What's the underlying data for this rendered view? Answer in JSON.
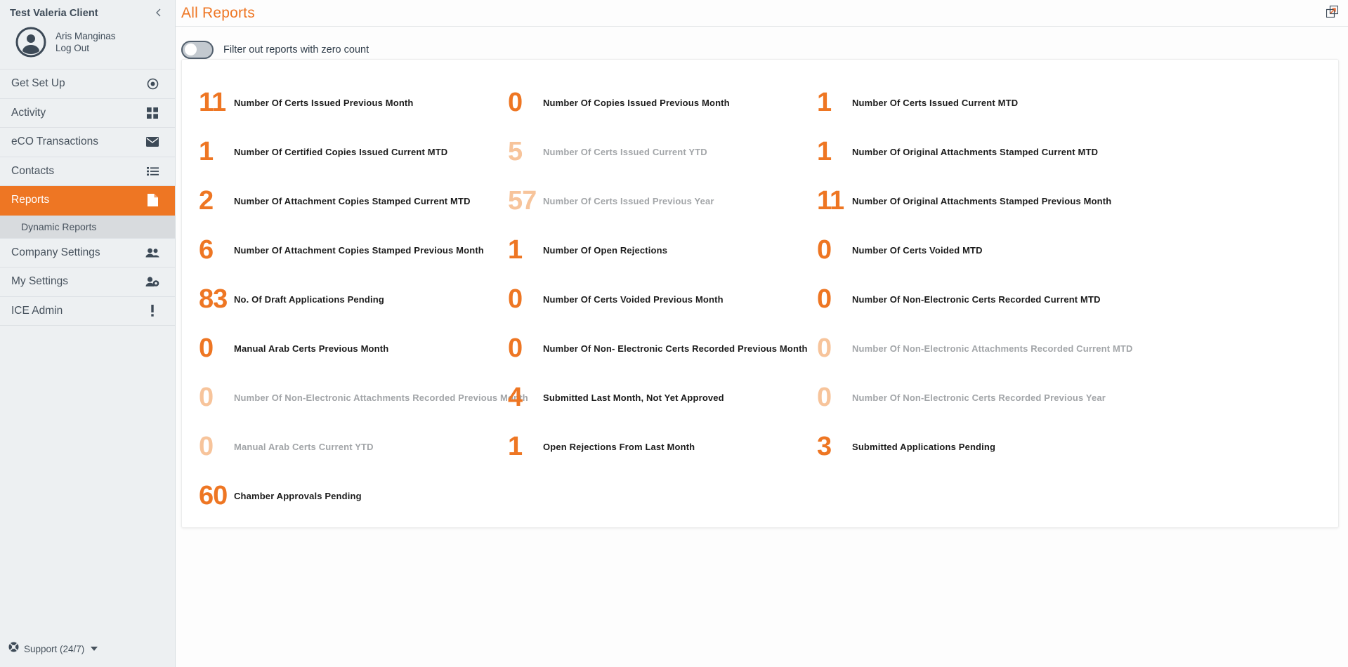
{
  "sidebar": {
    "client_name": "Test Valeria Client",
    "collapse_icon": "chevron-left-icon",
    "user": {
      "name": "Aris Manginas",
      "logout_label": "Log Out",
      "avatar_icon": "user-circle-icon"
    },
    "items": [
      {
        "label": "Get Set Up",
        "icon": "target-icon",
        "active": false
      },
      {
        "label": "Activity",
        "icon": "grid-icon",
        "active": false
      },
      {
        "label": "eCO Transactions",
        "icon": "envelope-icon",
        "active": false
      },
      {
        "label": "Contacts",
        "icon": "list-icon",
        "active": false
      },
      {
        "label": "Reports",
        "icon": "document-icon",
        "active": true
      },
      {
        "label": "Company Settings",
        "icon": "people-icon",
        "active": false
      },
      {
        "label": "My Settings",
        "icon": "user-gear-icon",
        "active": false
      },
      {
        "label": "ICE Admin",
        "icon": "exclamation-icon",
        "active": false
      }
    ],
    "sub_item": {
      "label": "Dynamic Reports",
      "parent": "Reports"
    },
    "footer": {
      "label": "Support (24/7)",
      "icon": "lifebuoy-icon",
      "caret": "caret-down-icon"
    }
  },
  "header": {
    "title": "All Reports",
    "expand_icon": "expand-window-icon"
  },
  "filter": {
    "toggle_state": "off",
    "label": "Filter out reports with zero count"
  },
  "colors": {
    "accent": "#ee7623",
    "accent_dim": "#f7c49b",
    "sidebar_bg": "#edf0f2",
    "text": "#47525d",
    "text_dim": "#a2a5a8"
  },
  "reports": {
    "columns": [
      [
        {
          "value": "11",
          "label": "Number Of Certs Issued Previous Month",
          "dim": false
        },
        {
          "value": "1",
          "label": "Number Of Certified Copies Issued Current MTD",
          "dim": false
        },
        {
          "value": "2",
          "label": "Number Of Attachment Copies Stamped Current MTD",
          "dim": false
        },
        {
          "value": "6",
          "label": "Number Of Attachment Copies Stamped Previous Month",
          "dim": false
        },
        {
          "value": "83",
          "label": "No. Of Draft Applications Pending",
          "dim": false
        },
        {
          "value": "0",
          "label": "Manual Arab Certs Previous Month",
          "dim": false
        },
        {
          "value": "0",
          "label": "Number Of Non-Electronic Attachments Recorded Previous Month",
          "dim": true
        },
        {
          "value": "0",
          "label": "Manual Arab Certs Current YTD",
          "dim": true
        },
        {
          "value": "60",
          "label": "Chamber Approvals Pending",
          "dim": false
        }
      ],
      [
        {
          "value": "0",
          "label": "Number Of Copies Issued Previous Month",
          "dim": false
        },
        {
          "value": "5",
          "label": "Number Of Certs Issued Current YTD",
          "dim": true
        },
        {
          "value": "57",
          "label": "Number Of Certs Issued Previous Year",
          "dim": true
        },
        {
          "value": "1",
          "label": "Number Of Open Rejections",
          "dim": false
        },
        {
          "value": "0",
          "label": "Number Of Certs Voided Previous Month",
          "dim": false
        },
        {
          "value": "0",
          "label": "Number Of Non- Electronic Certs Recorded Previous Month",
          "dim": false
        },
        {
          "value": "4",
          "label": "Submitted Last Month, Not Yet Approved",
          "dim": false
        },
        {
          "value": "1",
          "label": "Open Rejections From Last Month",
          "dim": false
        }
      ],
      [
        {
          "value": "1",
          "label": "Number Of Certs Issued Current MTD",
          "dim": false
        },
        {
          "value": "1",
          "label": "Number Of Original Attachments Stamped Current MTD",
          "dim": false
        },
        {
          "value": "11",
          "label": "Number Of Original Attachments Stamped Previous Month",
          "dim": false
        },
        {
          "value": "0",
          "label": "Number Of Certs Voided MTD",
          "dim": false
        },
        {
          "value": "0",
          "label": "Number Of Non-Electronic Certs Recorded Current MTD",
          "dim": false
        },
        {
          "value": "0",
          "label": "Number Of Non-Electronic Attachments Recorded Current MTD",
          "dim": true
        },
        {
          "value": "0",
          "label": "Number Of Non-Electronic Certs Recorded Previous Year",
          "dim": true
        },
        {
          "value": "3",
          "label": "Submitted Applications Pending",
          "dim": false
        }
      ]
    ]
  }
}
